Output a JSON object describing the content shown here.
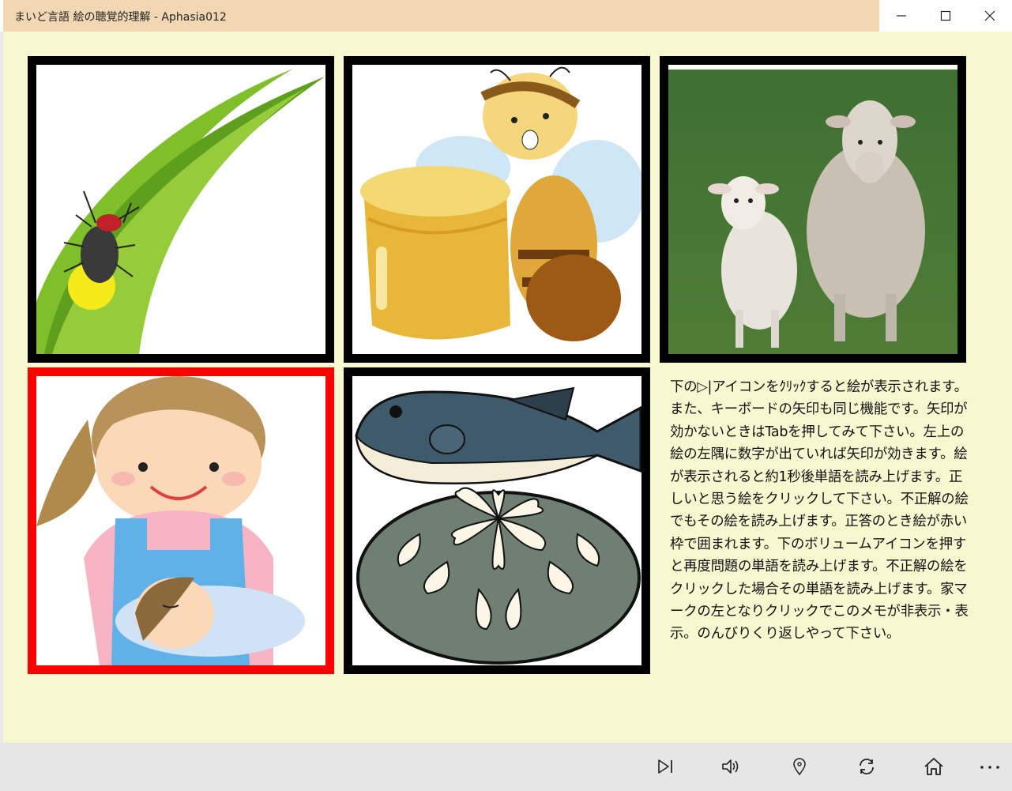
{
  "window": {
    "title": "まいど言語 絵の聴覚的理解 - Aphasia012",
    "buttons": [
      {
        "name": "minimize",
        "icon": "minimize-icon"
      },
      {
        "name": "maximize",
        "icon": "maximize-icon"
      },
      {
        "name": "close",
        "icon": "close-icon"
      }
    ]
  },
  "tiles": [
    {
      "subject": "firefly on grass leaf",
      "selected": false
    },
    {
      "subject": "bee with honey pot",
      "selected": false
    },
    {
      "subject": "sheep",
      "selected": false
    },
    {
      "subject": "mother caring for child",
      "selected": true
    },
    {
      "subject": "fugu pufferfish and sashimi platter",
      "selected": false
    }
  ],
  "memo": {
    "text": "下の▷|アイコンをｸﾘｯｸすると絵が表示されます。また、キーボードの矢印も同じ機能です。矢印が効かないときはTabを押してみて下さい。左上の絵の左隅に数字が出ていれば矢印が効きます。絵が表示されると約1秒後単語を読み上げます。正しいと思う絵をクリックして下さい。不正解の絵でもその絵を読み上げます。正答のとき絵が赤い枠で囲まれます。下のボリュームアイコンを押すと再度問題の単語を読み上げます。不正解の絵をクリックした場合その単語を読み上げます。家マークの左となりクリックでこのメモが非表示・表示。のんびりくり返しやって下さい。"
  },
  "colors": {
    "background": "#f7f7d0",
    "titlebar": "#f2d8b2",
    "tile_border": "#000000",
    "selected_border": "#ff0000",
    "bottombar": "#e6e6e6"
  },
  "bottombar": {
    "buttons": [
      {
        "name": "next",
        "icon": "skip-next-icon"
      },
      {
        "name": "volume",
        "icon": "volume-icon"
      },
      {
        "name": "memo-toggle",
        "icon": "map-pin-icon"
      },
      {
        "name": "refresh",
        "icon": "refresh-icon"
      },
      {
        "name": "home",
        "icon": "home-icon"
      },
      {
        "name": "more",
        "icon": "more-icon"
      }
    ]
  }
}
